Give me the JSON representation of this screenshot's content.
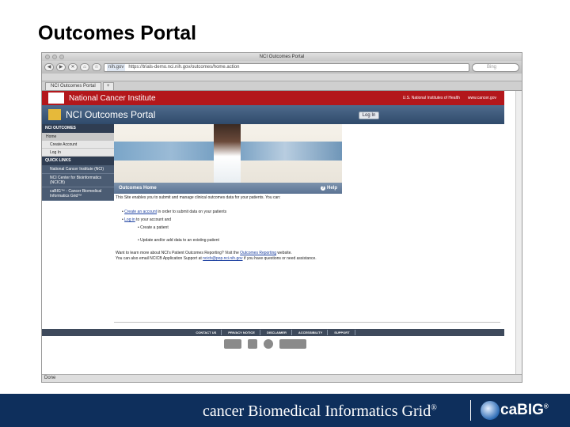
{
  "slide": {
    "title": "Outcomes Portal"
  },
  "browser": {
    "window_title": "NCI Outcomes Portal",
    "url_domain": "nih.gov",
    "url": "https://trials-demo.nci.nih.gov/outcomes/home.action",
    "search_placeholder": "Bing",
    "tab_label": "NCI Outcomes Portal",
    "new_tab": "+",
    "status": "Done"
  },
  "site": {
    "institute": "National Cancer Institute",
    "nih_link": "U.S. National Institutes of Health",
    "cancer_gov": "www.cancer.gov",
    "portal_title": "NCI Outcomes Portal",
    "login_button": "Log In"
  },
  "sidebar": {
    "section1": "NCI OUTCOMES",
    "items": [
      "Home",
      "Create Account",
      "Log In"
    ],
    "section2": "QUICK LINKS",
    "links": [
      "National Cancer Institute (NCI)",
      "NCI Center for Bioinformatics (NCICB)",
      "caBIG™ - Cancer Biomedical Informatics Grid™"
    ]
  },
  "content": {
    "heading": "Outcomes Home",
    "help": "Help",
    "intro": "This Site enables you to submit and manage clinical outcomes data for your patients. You can:",
    "bullet1_link": "Create an account",
    "bullet1_rest": " in order to submit data on your patients",
    "bullet2_link": "Log in",
    "bullet2_rest": " to your account and",
    "sub1": "Create a patient",
    "sub2": "Update and/or add data to an existing patient",
    "more1_pre": "Want to learn more about NCI's Patient Outcomes Reporting? Visit the ",
    "more1_link": "Outcomes Reporting",
    "more1_post": " website.",
    "more2_pre": "You can also email NCICB Application Support at ",
    "more2_link": "ncicb@pop.nci.nih.gov",
    "more2_post": " if you have questions or need assistance."
  },
  "footer": {
    "links": [
      "CONTACT US",
      "PRIVACY NOTICE",
      "DISCLAIMER",
      "ACCESSIBILITY",
      "SUPPORT"
    ]
  },
  "bottom": {
    "cbig": "cancer Biomedical Informatics Grid",
    "reg": "®",
    "cabig": "caBIG",
    "tm": "®"
  }
}
